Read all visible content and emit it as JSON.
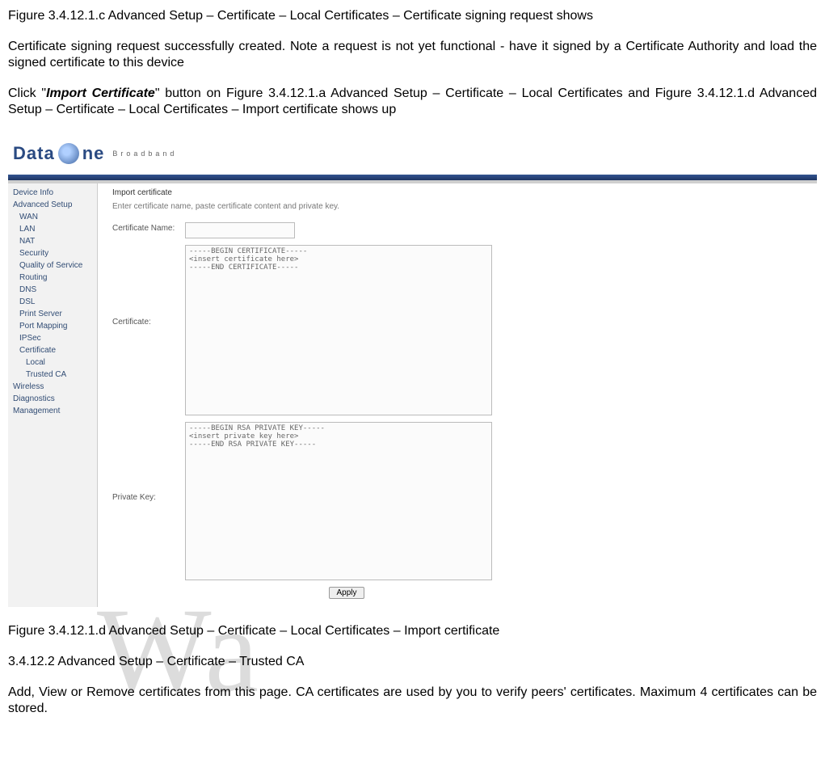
{
  "text": {
    "para1": "Figure 3.4.12.1.c Advanced Setup – Certificate – Local Certificates – Certificate signing request shows",
    "para2": "Certificate signing request successfully created. Note a request is not yet functional - have it signed by a Certificate Authority and load the signed certificate to this device",
    "para3a": "Click \"",
    "para3b": "Import Certificate",
    "para3c": "\" button on Figure 3.4.12.1.a Advanced Setup – Certificate – Local Certificates and Figure 3.4.12.1.d Advanced Setup – Certificate – Local Certificates – Import certificate shows up",
    "caption": "Figure 3.4.12.1.d Advanced Setup – Certificate – Local Certificates – Import certificate",
    "section": "3.4.12.2 Advanced Setup – Certificate – Trusted CA",
    "para4": "Add, View or Remove certificates from this page. CA certificates are used by you to verify peers' certificates. Maximum 4 certificates can be stored."
  },
  "logo": {
    "t1": "Data",
    "t2": "ne",
    "sub": "Broadband"
  },
  "sidebar": {
    "items": [
      {
        "label": "Device Info",
        "cls": "item"
      },
      {
        "label": "Advanced Setup",
        "cls": "item"
      },
      {
        "label": "WAN",
        "cls": "item sub"
      },
      {
        "label": "LAN",
        "cls": "item sub"
      },
      {
        "label": "NAT",
        "cls": "item sub"
      },
      {
        "label": "Security",
        "cls": "item sub"
      },
      {
        "label": "Quality of Service",
        "cls": "item sub"
      },
      {
        "label": "Routing",
        "cls": "item sub"
      },
      {
        "label": "DNS",
        "cls": "item sub"
      },
      {
        "label": "DSL",
        "cls": "item sub"
      },
      {
        "label": "Print Server",
        "cls": "item sub"
      },
      {
        "label": "Port Mapping",
        "cls": "item sub"
      },
      {
        "label": "IPSec",
        "cls": "item sub"
      },
      {
        "label": "Certificate",
        "cls": "item sub"
      },
      {
        "label": "Local",
        "cls": "item sub2"
      },
      {
        "label": "Trusted CA",
        "cls": "item sub2"
      },
      {
        "label": "Wireless",
        "cls": "item"
      },
      {
        "label": "Diagnostics",
        "cls": "item"
      },
      {
        "label": "Management",
        "cls": "item"
      }
    ]
  },
  "content": {
    "title": "Import certificate",
    "desc": "Enter certificate name, paste certificate content and private key.",
    "label_name": "Certificate Name:",
    "label_cert": "Certificate:",
    "label_key": "Private Key:",
    "cert_value": "-----BEGIN CERTIFICATE-----\n<insert certificate here>\n-----END CERTIFICATE-----",
    "key_value": "-----BEGIN RSA PRIVATE KEY-----\n<insert private key here>\n-----END RSA PRIVATE KEY-----",
    "apply": "Apply"
  },
  "watermark": "Wa"
}
